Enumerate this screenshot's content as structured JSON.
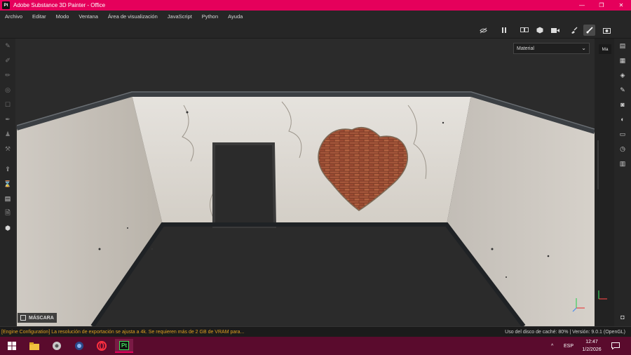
{
  "window": {
    "logo_text": "Pt",
    "title": "Adobe Substance 3D Painter - Office",
    "controls": [
      "—",
      "❐",
      "✕"
    ]
  },
  "menu": [
    "Archivo",
    "Editar",
    "Modo",
    "Ventana",
    "Área de visualización",
    "JavaScript",
    "Python",
    "Ayuda"
  ],
  "toolbar": {
    "icons": [
      "hide-icon",
      "pause-icon",
      "split-view-icon",
      "cube-icon",
      "camera-video-icon",
      "mask-brush-icon",
      "paint-brush-icon",
      "screenshot-icon"
    ]
  },
  "viewport": {
    "material_select": "Material",
    "panel_tab": "Ma",
    "mask_label": "MÁSCARA"
  },
  "statusbar": {
    "warning": "[Engine Configuration] La resolución de exportación se ajusta a 4k. Se requieren más de 2 GB de VRAM para...",
    "info": "Uso del disco de caché: 80% | Versión: 9.0.1 (OpenGL)"
  },
  "taskbar": {
    "language": "ESP",
    "time": "12:47",
    "date": "1/2/2026",
    "active_app_text": "Pt"
  },
  "colors": {
    "accent": "#e5005b",
    "taskbar": "#5a0b2d",
    "warning": "#e0a020"
  }
}
